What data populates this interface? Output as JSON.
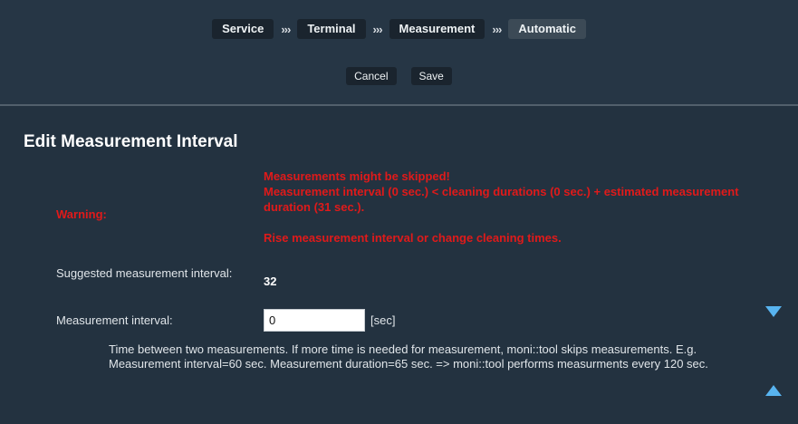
{
  "breadcrumb": {
    "items": [
      "Service",
      "Terminal",
      "Measurement",
      "Automatic"
    ],
    "separator": "›››"
  },
  "actions": {
    "cancel_label": "Cancel",
    "save_label": "Save"
  },
  "page": {
    "title": "Edit Measurement Interval"
  },
  "warning": {
    "label": "Warning:",
    "line1": "Measurements might be skipped!",
    "line2": "Measurement interval (0 sec.) < cleaning durations (0 sec.) + estimated measurement duration (31 sec.).",
    "line3": "Rise measurement interval or change cleaning times."
  },
  "suggested": {
    "label": "Suggested measurement interval:",
    "value": "32"
  },
  "interval": {
    "label": "Measurement interval:",
    "value": "0",
    "unit": "[sec]"
  },
  "help_text": "Time between two measurements. If more time is needed for measurement, moni::tool skips measurements. E.g. Measurement interval=60 sec. Measurement duration=65 sec. => moni::tool performs measurments every 120 sec.",
  "icons": {
    "scroll_down": "triangle-down-icon",
    "scroll_up": "triangle-up-icon"
  },
  "colors": {
    "warning": "#e01a1a",
    "accent": "#58b4f0",
    "background": "#233240"
  }
}
